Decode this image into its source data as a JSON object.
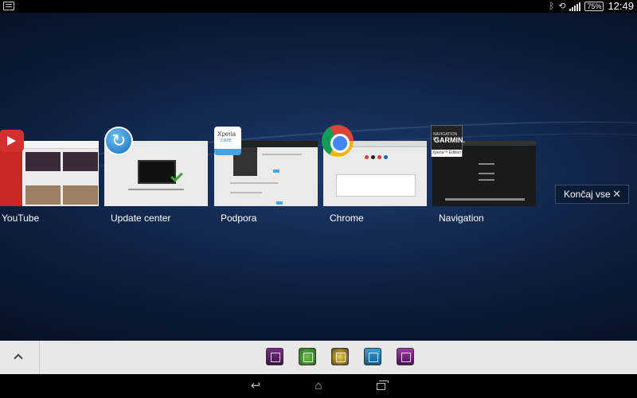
{
  "status_bar": {
    "battery": "75%",
    "time": "12:49"
  },
  "recent_apps": [
    {
      "label": "YouTube",
      "icon": "youtube-icon"
    },
    {
      "label": "Update center",
      "icon": "update-center-icon"
    },
    {
      "label": "Podpora",
      "icon": "xperia-care-icon"
    },
    {
      "label": "Chrome",
      "icon": "chrome-icon"
    },
    {
      "label": "Navigation",
      "icon": "garmin-icon"
    }
  ],
  "xperia_icon": {
    "line1": "Xperia",
    "line2": "care"
  },
  "garmin_icon": {
    "line1": "NAVIGATION BY",
    "line2": "GARMIN.",
    "line3": "Xperia™ Edition"
  },
  "close_all": {
    "label": "Končaj vse",
    "close_glyph": "✕"
  },
  "dock": {
    "up_glyph": "chevron-up-icon",
    "mini_apps": [
      "mini-app-1",
      "mini-app-2",
      "mini-app-3",
      "mini-app-4",
      "mini-app-5"
    ]
  },
  "navbar": {
    "back_glyph": "↩",
    "home_glyph": "⌂"
  },
  "colors": {
    "wallpaper": "#132a52",
    "dock": "#e8e8e8",
    "accent": "#4aa3e0"
  }
}
